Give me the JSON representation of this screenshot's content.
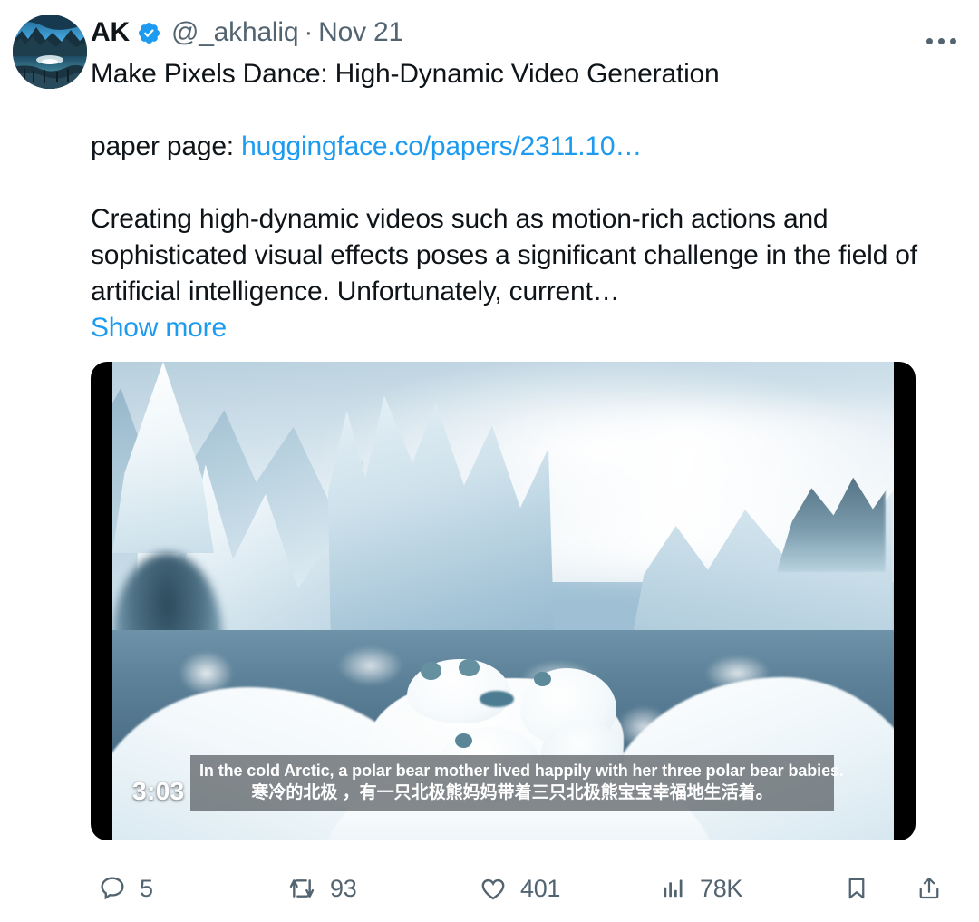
{
  "tweet": {
    "author": {
      "display_name": "AK",
      "handle": "@_akhaliq",
      "verified_badge": "verified-badge-icon",
      "avatar_alt": "avatar-landscape-lake"
    },
    "timestamp": "Nov 21",
    "separator": "·",
    "more_menu_label": "more-options",
    "text": {
      "title_line": "Make Pixels Dance: High-Dynamic Video Generation",
      "paper_label": "paper page: ",
      "paper_link": "huggingface.co/papers/2311.10…",
      "abstract": "Creating high-dynamic videos such as motion-rich actions and sophisticated visual effects poses a significant challenge in the field of artificial intelligence. Unfortunately, current…",
      "show_more": "Show more"
    },
    "media": {
      "type": "video",
      "duration": "3:03",
      "caption_en": "In the cold Arctic, a polar bear mother lived happily with her three polar bear babies.",
      "caption_zh": "寒冷的北极 ，有一只北极熊妈妈带着三只北极熊宝宝幸福地生活着。",
      "scene_description": "arctic-icebergs-with-polar-bears"
    },
    "actions": {
      "reply": {
        "icon": "reply-icon",
        "count": "5"
      },
      "retweet": {
        "icon": "retweet-icon",
        "count": "93"
      },
      "like": {
        "icon": "heart-icon",
        "count": "401"
      },
      "views": {
        "icon": "analytics-icon",
        "count": "78K"
      },
      "bookmark": {
        "icon": "bookmark-icon",
        "count": ""
      },
      "share": {
        "icon": "share-icon",
        "count": ""
      }
    }
  },
  "colors": {
    "text_primary": "#0f1419",
    "text_secondary": "#536471",
    "link_blue": "#1d9bf0",
    "verified_blue": "#1d9bf0",
    "background": "#ffffff"
  }
}
